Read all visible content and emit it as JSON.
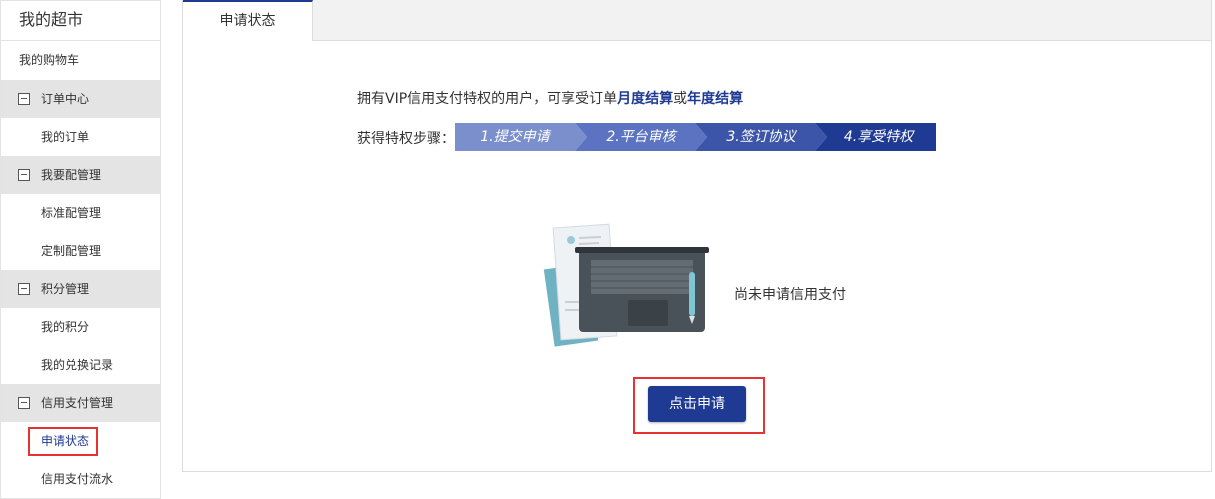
{
  "sidebar": {
    "title": "我的超市",
    "cart": "我的购物车",
    "groups": [
      {
        "label": "订单中心",
        "items": [
          "我的订单"
        ]
      },
      {
        "label": "我要配管理",
        "items": [
          "标准配管理",
          "定制配管理"
        ]
      },
      {
        "label": "积分管理",
        "items": [
          "我的积分",
          "我的兑换记录"
        ]
      },
      {
        "label": "信用支付管理",
        "items": [
          "申请状态",
          "信用支付流水"
        ]
      }
    ],
    "active_item": "申请状态"
  },
  "tabs": [
    "申请状态"
  ],
  "intro": {
    "prefix": "拥有VIP信用支付特权的用户，可享受订单",
    "monthly": "月度结算",
    "or": "或",
    "yearly": "年度结算"
  },
  "steps": {
    "label": "获得特权步骤：",
    "items": [
      "1.提交申请",
      "2.平台审核",
      "3.签订协议",
      "4.享受特权"
    ],
    "colors": [
      "#7a8fcc",
      "#5b73c0",
      "#3c55a8",
      "#1f3a93"
    ]
  },
  "empty_state": {
    "icon": "laptop-documents-icon",
    "message": "尚未申请信用支付"
  },
  "apply_button": "点击申请",
  "colors": {
    "accent": "#1f3a93",
    "highlight": "#e53333"
  }
}
